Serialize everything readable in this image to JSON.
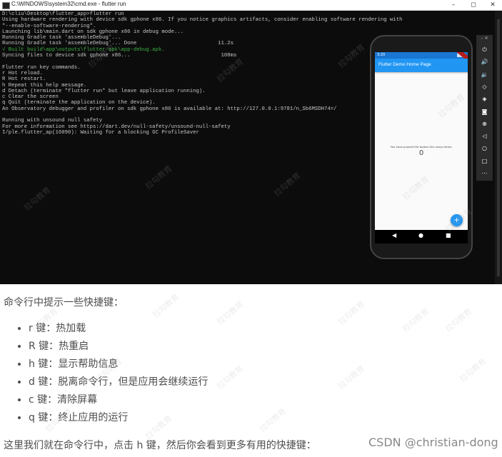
{
  "window": {
    "title": "C:\\WINDOWS\\system32\\cmd.exe - flutter  run",
    "minimize": "–",
    "maximize": "◻",
    "close": "✕"
  },
  "console_lines": [
    {
      "text": "D:\\cliu\\Desktop\\flutter_app>flutter run",
      "color": "default"
    },
    {
      "text": "Using hardware rendering with device sdk gphone x86. If you notice graphics artifacts, consider enabling software rendering with",
      "color": "default"
    },
    {
      "text": "\"--enable-software-rendering\".",
      "color": "default"
    },
    {
      "text": "Launching lib\\main.dart on sdk gphone x86 in debug mode...",
      "color": "default"
    },
    {
      "text": "Running Gradle task 'assembleDebug'...",
      "color": "default"
    },
    {
      "text": "Running Gradle task 'assembleDebug'... Done                          11.2s",
      "color": "default"
    },
    {
      "text": "√ Built build\\app\\outputs\\flutter-apk\\app-debug.apk.",
      "color": "green"
    },
    {
      "text": "Syncing files to device sdk gphone x86...                             108ms",
      "color": "default"
    },
    {
      "text": "",
      "color": "blank"
    },
    {
      "text": "Flutter run key commands.",
      "color": "default"
    },
    {
      "text": "r Hot reload.",
      "color": "default"
    },
    {
      "text": "R Hot restart.",
      "color": "default"
    },
    {
      "text": "h Repeat this help message.",
      "color": "default"
    },
    {
      "text": "d Detach (terminate \"flutter run\" but leave application running).",
      "color": "default"
    },
    {
      "text": "c Clear the screen",
      "color": "default"
    },
    {
      "text": "q Quit (terminate the application on the device).",
      "color": "default"
    },
    {
      "text": "An Observatory debugger and profiler on sdk gphone x86 is available at: http://127.0.0.1:9781/n_Sb6MSDH74=/",
      "color": "default"
    },
    {
      "text": "",
      "color": "blank"
    },
    {
      "text": "Running with unsound null safety",
      "color": "default"
    },
    {
      "text": "For more information see https://dart.dev/null-safety/unsound-null-safety",
      "color": "default"
    },
    {
      "text": "I/ple.flutter_ap(16090): Waiting for a blocking GC ProfileSaver",
      "color": "default"
    }
  ],
  "emulator": {
    "status_time": "3:20",
    "app_title": "Flutter Demo Home Page",
    "message": "You have pushed the button this many times:",
    "counter": "0",
    "fab_label": "+",
    "nav": {
      "back": "◀",
      "home": "●",
      "recent": "■"
    },
    "toolbar_top": "– ×",
    "toolbar_icons": [
      "power-icon",
      "volume-up-icon",
      "volume-down-icon",
      "rotate-left-icon",
      "rotate-right-icon",
      "camera-icon",
      "zoom-icon",
      "back-icon",
      "home-icon",
      "overview-icon",
      "more-icon"
    ],
    "toolbar_glyphs": [
      "⏻",
      "🔊",
      "🔉",
      "◇",
      "◈",
      "◙",
      "⊕",
      "◁",
      "○",
      "□",
      "⋯"
    ]
  },
  "article": {
    "intro": "命令行中提示一些快捷键：",
    "items": [
      "r 键：热加载",
      "R 键：热重启",
      "h 键：显示帮助信息",
      "d 键：脱离命令行，但是应用会继续运行",
      "c 键：清除屏幕",
      "q 键：终止应用的运行"
    ],
    "footer": "这里我们就在命令行中，点击 h 键，然后你会看到更多有用的快捷键："
  },
  "watermark_text": "拉勾教育",
  "credit": "CSDN @christian-dong"
}
